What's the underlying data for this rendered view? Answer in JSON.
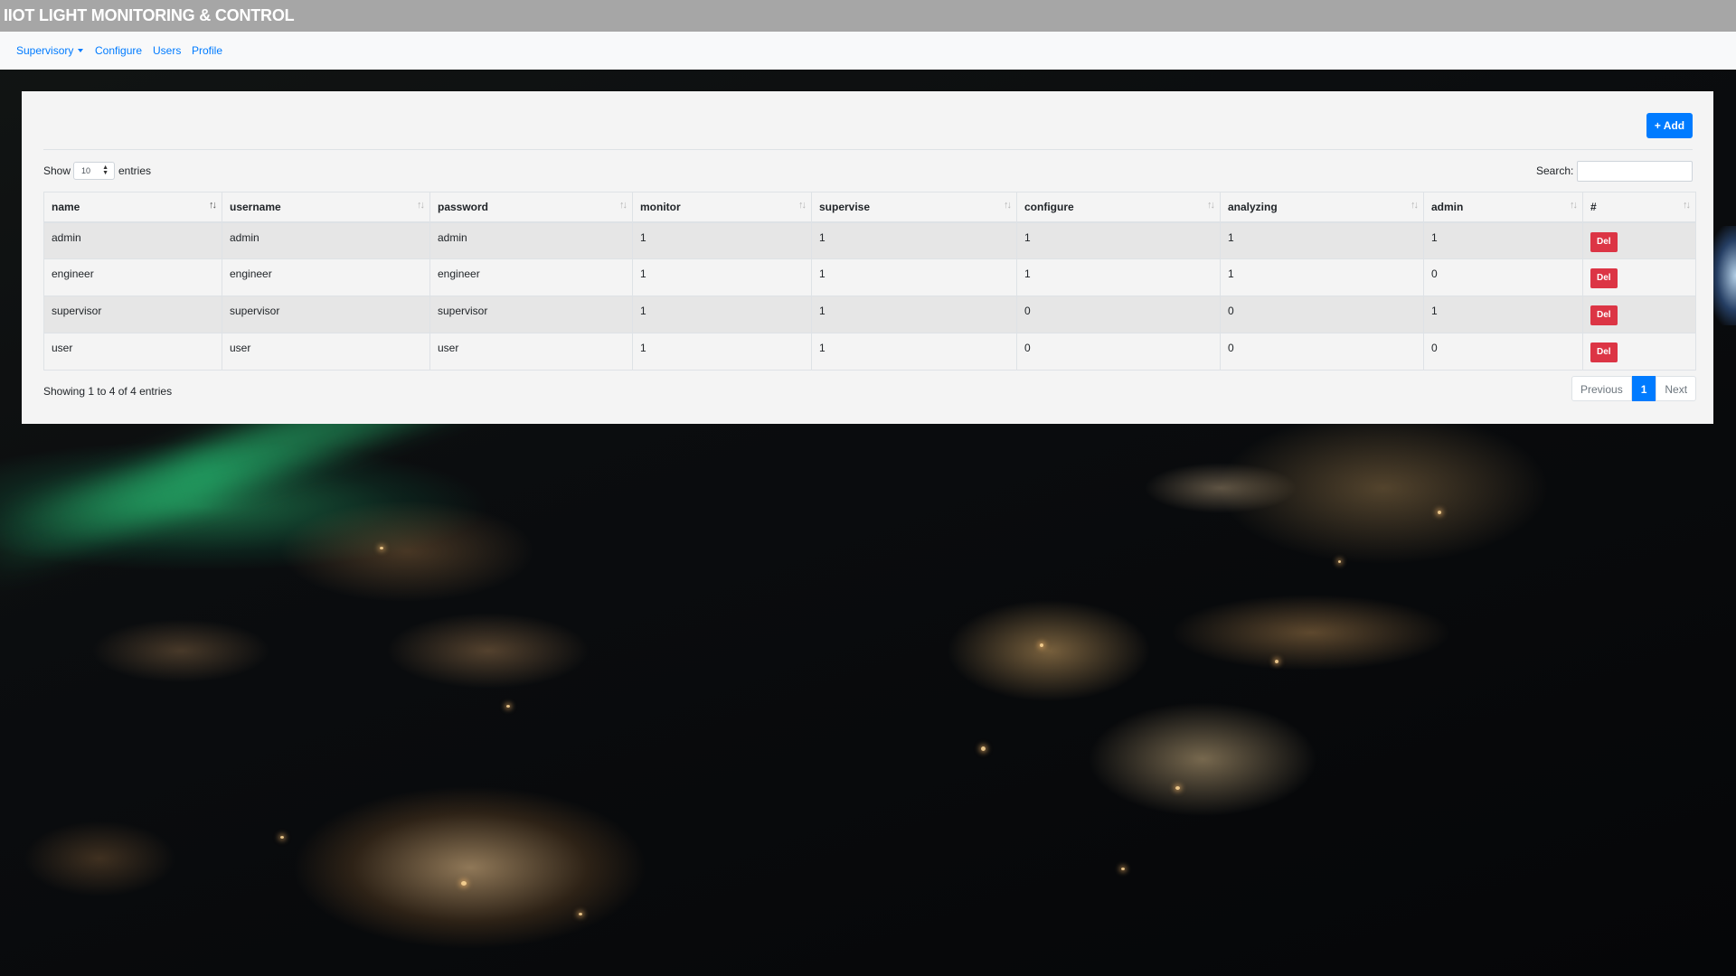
{
  "app": {
    "title": "IIOT LIGHT MONITORING & CONTROL"
  },
  "nav": {
    "items": [
      {
        "label": "Supervisory",
        "has_dropdown": true
      },
      {
        "label": "Configure"
      },
      {
        "label": "Users"
      },
      {
        "label": "Profile"
      }
    ]
  },
  "toolbar": {
    "add_label": "+ Add"
  },
  "length": {
    "show_label": "Show",
    "value": "10",
    "entries_label": "entries"
  },
  "search": {
    "label": "Search:",
    "value": ""
  },
  "table": {
    "columns": [
      "name",
      "username",
      "password",
      "monitor",
      "supervise",
      "configure",
      "analyzing",
      "admin",
      "#"
    ],
    "rows": [
      {
        "name": "admin",
        "username": "admin",
        "password": "admin",
        "monitor": "1",
        "supervise": "1",
        "configure": "1",
        "analyzing": "1",
        "admin": "1",
        "action": "Del"
      },
      {
        "name": "engineer",
        "username": "engineer",
        "password": "engineer",
        "monitor": "1",
        "supervise": "1",
        "configure": "1",
        "analyzing": "1",
        "admin": "0",
        "action": "Del"
      },
      {
        "name": "supervisor",
        "username": "supervisor",
        "password": "supervisor",
        "monitor": "1",
        "supervise": "1",
        "configure": "0",
        "analyzing": "0",
        "admin": "1",
        "action": "Del"
      },
      {
        "name": "user",
        "username": "user",
        "password": "user",
        "monitor": "1",
        "supervise": "1",
        "configure": "0",
        "analyzing": "0",
        "admin": "0",
        "action": "Del"
      }
    ]
  },
  "footer": {
    "info": "Showing 1 to 4 of 4 entries",
    "previous_label": "Previous",
    "current_page": "1",
    "next_label": "Next"
  },
  "colors": {
    "primary": "#007bff",
    "danger": "#dc3545",
    "titlebar": "#a6a6a6"
  },
  "icons": {
    "sort": "sort-icon",
    "dropdown": "caret-down-icon"
  }
}
